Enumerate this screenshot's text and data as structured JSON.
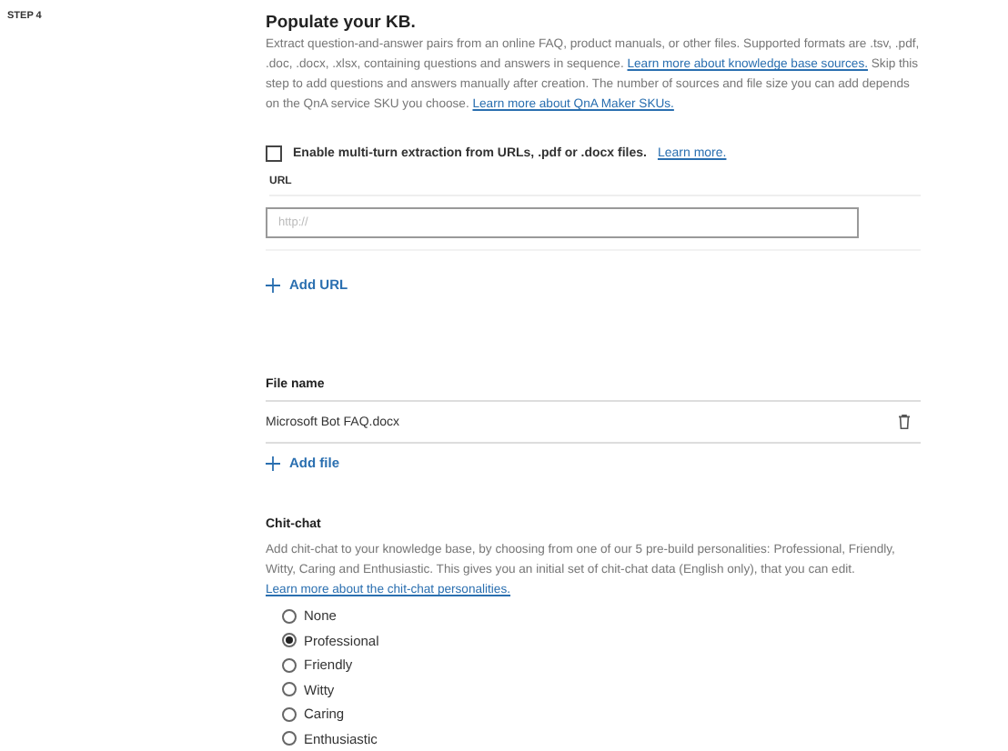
{
  "step": "STEP 4",
  "title": "Populate your KB.",
  "description": [
    {
      "kind": "text",
      "text": "Extract question-and-answer pairs from an online FAQ, product manuals, or other files. Supported formats are .tsv, .pdf, .doc, .docx, .xlsx, containing questions and answers in sequence. "
    },
    {
      "kind": "link",
      "text": "Learn more about knowledge base sources."
    },
    {
      "kind": "text",
      "text": " Skip this step to add questions and answers manually after creation. The number of sources and file size you can add depends on the QnA service SKU you choose. "
    },
    {
      "kind": "link",
      "text": "Learn more about QnA Maker SKUs."
    }
  ],
  "multi_turn": {
    "label": "Enable multi-turn extraction from URLs, .pdf or .docx files.",
    "link": "Learn more.",
    "checked": false
  },
  "url": {
    "label": "URL",
    "placeholder": "http://",
    "add": "Add URL"
  },
  "files": {
    "label": "File name",
    "rows": [
      "Microsoft Bot FAQ.docx"
    ],
    "add": "Add file"
  },
  "chit_chat": {
    "title": "Chit-chat",
    "description": [
      {
        "kind": "text",
        "text": "Add chit-chat to your knowledge base, by choosing from one of our 5 pre-build personalities: Professional, Friendly, Witty, Caring and Enthusiastic. This gives you an initial set of chit-chat data (English only), that you can edit. "
      },
      {
        "kind": "link",
        "text": "Learn more about the chit-chat personalities."
      }
    ],
    "options": [
      {
        "label": "None",
        "selected": false
      },
      {
        "label": "Professional",
        "selected": true
      },
      {
        "label": "Friendly",
        "selected": false
      },
      {
        "label": "Witty",
        "selected": false
      },
      {
        "label": "Caring",
        "selected": false
      },
      {
        "label": "Enthusiastic",
        "selected": false
      }
    ]
  }
}
